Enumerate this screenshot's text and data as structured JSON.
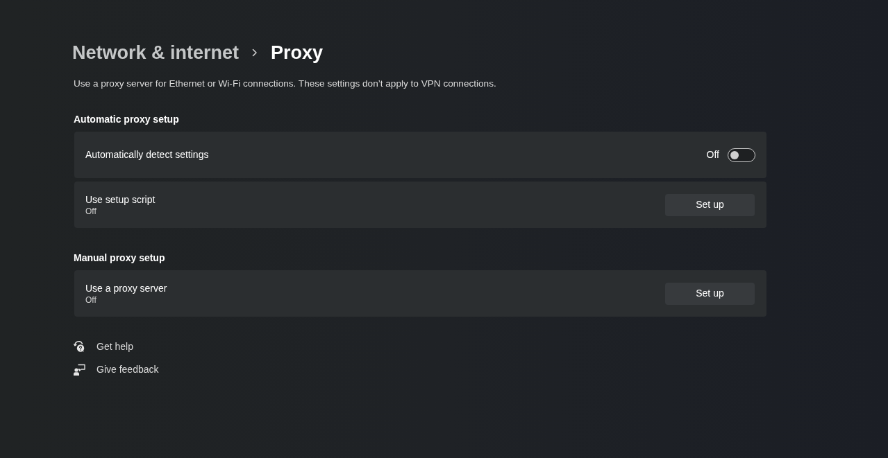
{
  "breadcrumb": [
    {
      "label": "Network & internet",
      "current": false
    },
    {
      "label": "Proxy",
      "current": true
    }
  ],
  "description": "Use a proxy server for Ethernet or Wi-Fi connections. These settings don’t apply to VPN connections.",
  "sections": [
    {
      "heading": "Automatic proxy setup",
      "rows": [
        {
          "kind": "toggle",
          "label": "Automatically detect settings",
          "state_text": "Off",
          "on": false
        },
        {
          "kind": "button",
          "label": "Use setup script",
          "status": "Off",
          "button": "Set up"
        }
      ]
    },
    {
      "heading": "Manual proxy setup",
      "rows": [
        {
          "kind": "button",
          "label": "Use a proxy server",
          "status": "Off",
          "button": "Set up"
        }
      ]
    }
  ],
  "links": [
    {
      "kind": "help",
      "label": "Get help"
    },
    {
      "kind": "feedback",
      "label": "Give feedback"
    }
  ]
}
